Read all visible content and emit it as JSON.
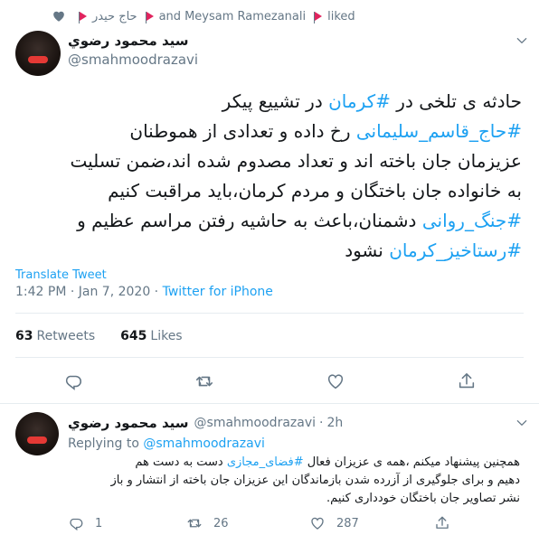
{
  "liked_bar": {
    "name1": "حاج حیدر",
    "and_text": "and",
    "name2": "Meysam Ramezanali",
    "liked": "liked"
  },
  "tweet": {
    "author_name": "سيد محمود رضوي",
    "handle": "@smahmoodrazavi",
    "lines": [
      {
        "parts": [
          {
            "t": "حادثه ی تلخی در ",
            "tag": false
          },
          {
            "t": "#کرمان",
            "tag": true
          },
          {
            "t": " در تشییع پیکر",
            "tag": false
          }
        ]
      },
      {
        "parts": [
          {
            "t": "#حاج_قاسم_سلیمانی",
            "tag": true
          },
          {
            "t": " رخ داده و تعدادی از هموطنان",
            "tag": false
          }
        ]
      },
      {
        "parts": [
          {
            "t": "عزیزمان جان باخته اند و تعداد مصدوم شده اند،ضمن تسلیت",
            "tag": false
          }
        ]
      },
      {
        "parts": [
          {
            "t": "به خانواده جان باختگان و مردم کرمان،باید مراقبت کنیم",
            "tag": false
          }
        ]
      },
      {
        "parts": [
          {
            "t": "#جنگ_روانی",
            "tag": true
          },
          {
            "t": " دشمنان،باعث به حاشیه رفتن مراسم عظیم و",
            "tag": false
          }
        ]
      },
      {
        "parts": [
          {
            "t": "#رستاخیز_کرمان",
            "tag": true
          },
          {
            "t": " نشود",
            "tag": false
          }
        ]
      }
    ],
    "translate": "Translate Tweet",
    "time": "1:42 PM · Jan 7, 2020 · ",
    "source": "Twitter for iPhone",
    "retweets_count": "63",
    "retweets_label": "Retweets",
    "likes_count": "645",
    "likes_label": "Likes"
  },
  "reply": {
    "author_name": "سيد محمود رضوي",
    "handle": "@smahmoodrazavi",
    "dot": "·",
    "age": "2h",
    "replying_label": "Replying to",
    "replying_to": "@smahmoodrazavi",
    "lines": [
      {
        "parts": [
          {
            "t": "همچنین پیشنهاد میکنم ،همه ی عزیزان فعال ",
            "tag": false
          },
          {
            "t": "#فضای_مجازی",
            "tag": true
          },
          {
            "t": " دست به دست هم",
            "tag": false
          }
        ]
      },
      {
        "parts": [
          {
            "t": "دهیم و برای جلوگیری از آزرده شدن بازماندگان این عزیزان جان باخته از انتشار و باز",
            "tag": false
          }
        ]
      },
      {
        "parts": [
          {
            "t": "نشر تصاویر جان باختگان خودداری کنیم.",
            "tag": false
          }
        ]
      }
    ],
    "replies": "1",
    "retweets": "26",
    "likes": "287"
  },
  "colors": {
    "accent": "#1da1f2",
    "muted": "#657786",
    "text": "#14171a",
    "divider": "#e6ecf0",
    "flag": "#e0245e"
  }
}
